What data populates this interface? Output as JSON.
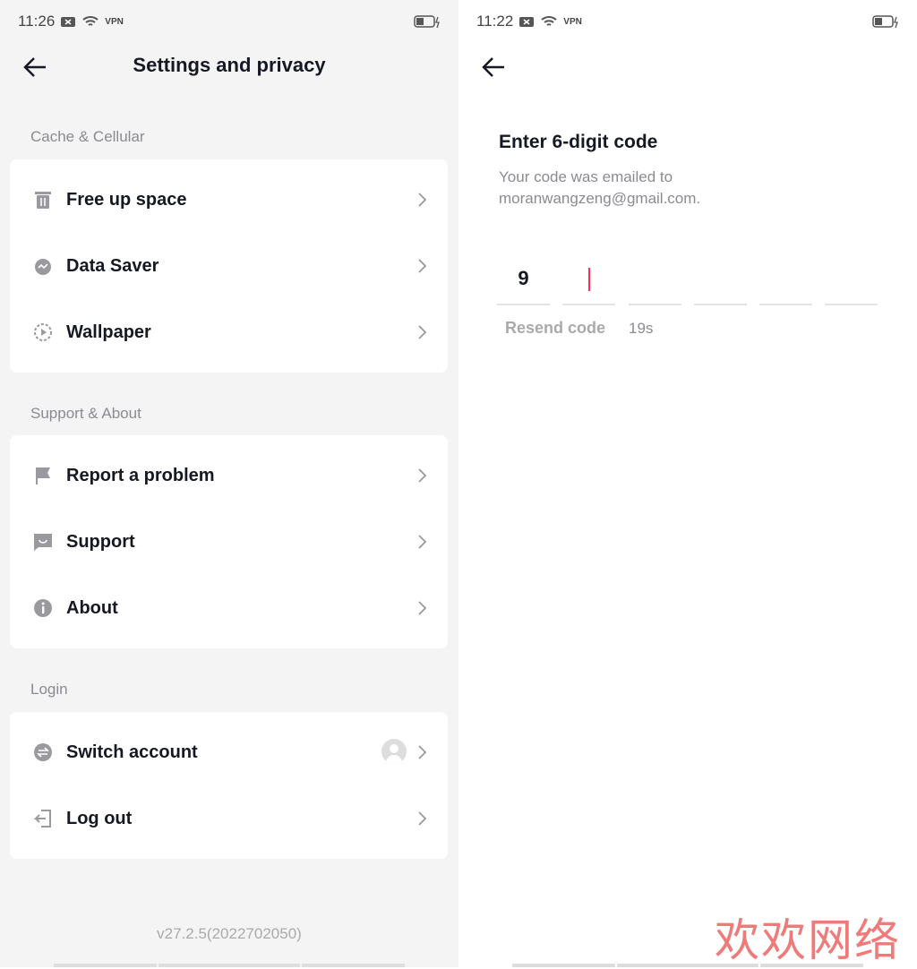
{
  "left": {
    "status": {
      "time": "11:26",
      "vpn": "VPN"
    },
    "title": "Settings and privacy",
    "sections": [
      {
        "label": "Cache & Cellular",
        "items": [
          {
            "label": "Free up space",
            "icon": "trash-icon"
          },
          {
            "label": "Data Saver",
            "icon": "data-saver-icon"
          },
          {
            "label": "Wallpaper",
            "icon": "wallpaper-icon"
          }
        ]
      },
      {
        "label": "Support & About",
        "items": [
          {
            "label": "Report a problem",
            "icon": "flag-icon"
          },
          {
            "label": "Support",
            "icon": "chat-icon"
          },
          {
            "label": "About",
            "icon": "info-icon"
          }
        ]
      },
      {
        "label": "Login",
        "items": [
          {
            "label": "Switch account",
            "icon": "switch-icon"
          },
          {
            "label": "Log out",
            "icon": "logout-icon"
          }
        ]
      }
    ],
    "version": "v27.2.5(2022702050)"
  },
  "right": {
    "status": {
      "time": "11:22",
      "vpn": "VPN"
    },
    "heading": "Enter 6-digit code",
    "subtitle_line1": "Your code was emailed to",
    "subtitle_line2": "moranwangzeng@gmail.com.",
    "code_digits": [
      "9",
      "",
      "",
      "",
      "",
      ""
    ],
    "resend_label": "Resend code",
    "timer": "19s"
  },
  "watermark": "欢欢网络",
  "colors": {
    "accent": "#fe2c55",
    "text": "#161823",
    "muted": "#8a8b91",
    "watermark": "#f07a7a"
  }
}
